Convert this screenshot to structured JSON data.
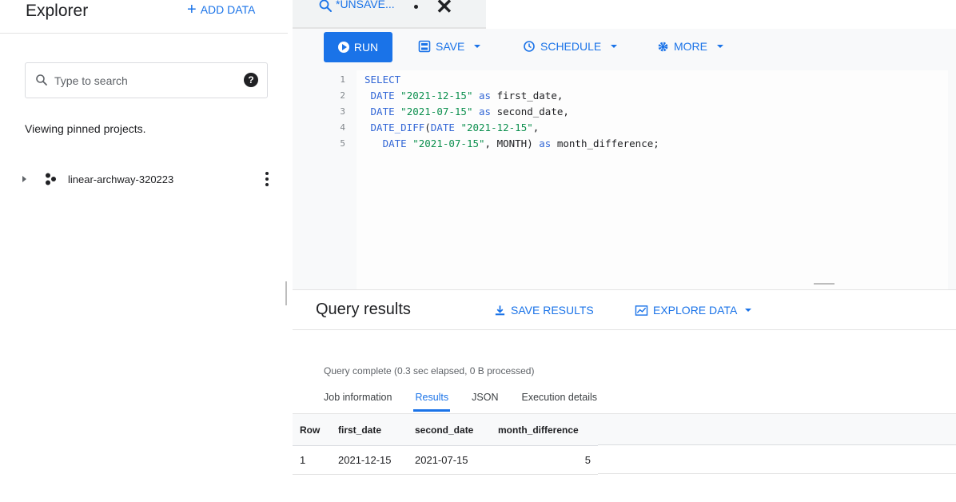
{
  "explorer": {
    "title": "Explorer",
    "add_data_label": "ADD DATA",
    "search_placeholder": "Type to search",
    "pinned_text": "Viewing pinned projects.",
    "project_name": "linear-archway-320223"
  },
  "editor": {
    "tab_label": "*UNSAVE...",
    "toolbar": {
      "run_label": "RUN",
      "save_label": "SAVE",
      "schedule_label": "SCHEDULE",
      "more_label": "MORE"
    },
    "line_numbers": [
      "1",
      "2",
      "3",
      "4",
      "5"
    ],
    "code_lines": [
      "SELECT",
      " DATE \"2021-12-15\" as first_date,",
      " DATE \"2021-07-15\" as second_date,",
      " DATE_DIFF(DATE \"2021-12-15\",",
      "   DATE \"2021-07-15\", MONTH) as month_difference;"
    ]
  },
  "results": {
    "title": "Query results",
    "save_results_label": "SAVE RESULTS",
    "explore_data_label": "EXPLORE DATA",
    "status": "Query complete (0.3 sec elapsed, 0 B processed)",
    "tabs": [
      "Job information",
      "Results",
      "JSON",
      "Execution details"
    ],
    "active_tab": "Results",
    "columns": [
      "Row",
      "first_date",
      "second_date",
      "month_difference"
    ],
    "rows": [
      [
        "1",
        "2021-12-15",
        "2021-07-15",
        "5"
      ]
    ]
  },
  "colors": {
    "accent": "#1a73e8",
    "keyword": "#3367d6",
    "string": "#0d904f"
  }
}
